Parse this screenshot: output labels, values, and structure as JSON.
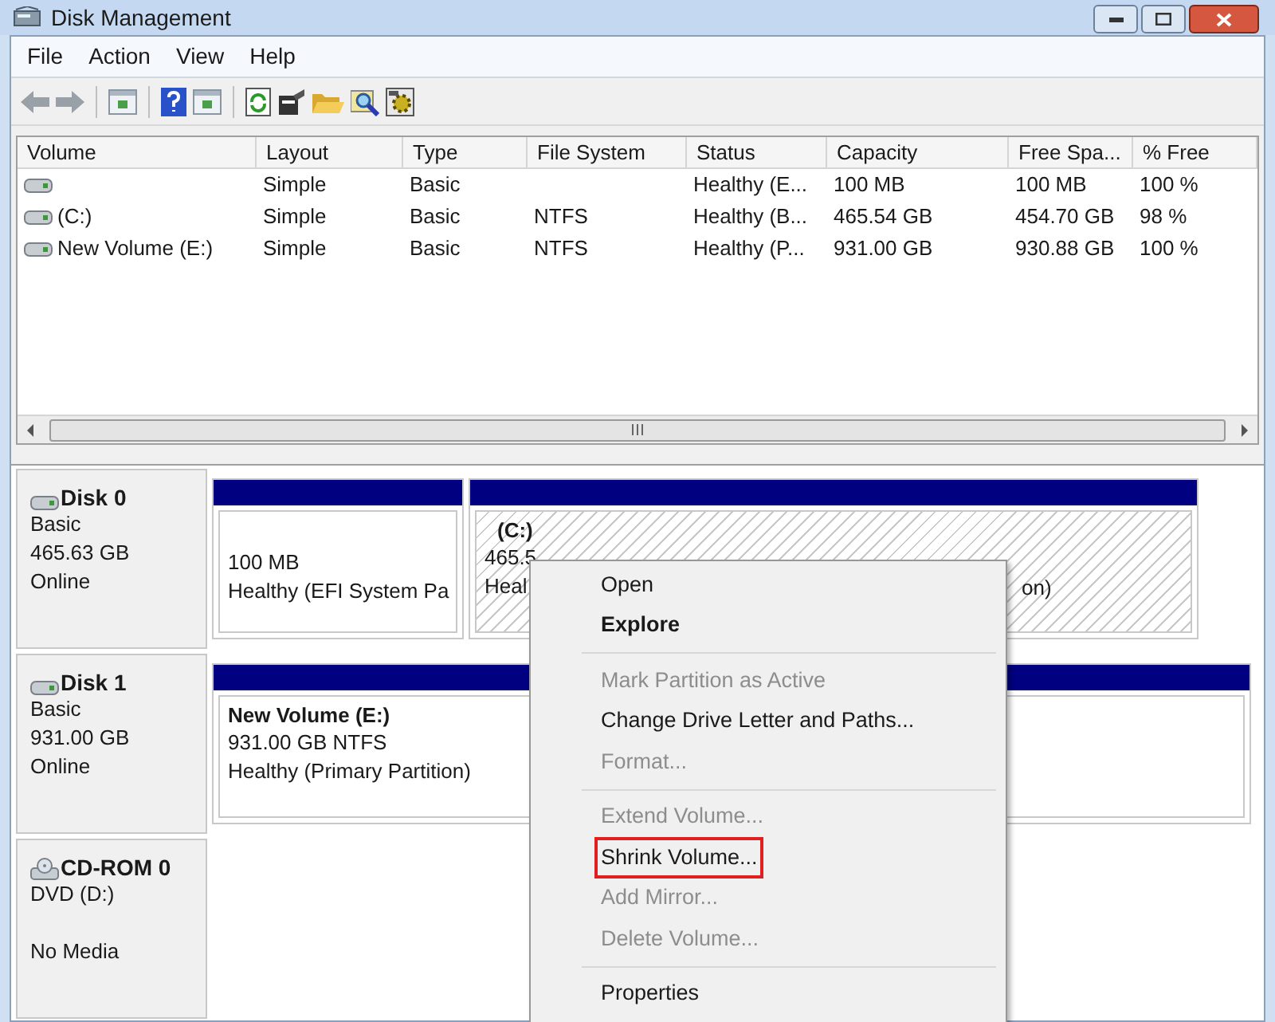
{
  "window": {
    "title": "Disk Management"
  },
  "menu_bar": [
    "File",
    "Action",
    "View",
    "Help"
  ],
  "volume_table": {
    "columns": [
      "Volume",
      "Layout",
      "Type",
      "File System",
      "Status",
      "Capacity",
      "Free Spa...",
      "% Free"
    ],
    "rows": [
      {
        "cells": [
          "",
          "Simple",
          "Basic",
          "",
          "Healthy (E...",
          "100 MB",
          "100 MB",
          "100 %"
        ]
      },
      {
        "cells": [
          "(C:)",
          "Simple",
          "Basic",
          "NTFS",
          "Healthy (B...",
          "465.54 GB",
          "454.70 GB",
          "98 %"
        ]
      },
      {
        "cells": [
          "New Volume (E:)",
          "Simple",
          "Basic",
          "NTFS",
          "Healthy (P...",
          "931.00 GB",
          "930.88 GB",
          "100 %"
        ]
      }
    ]
  },
  "disks": [
    {
      "name": "Disk 0",
      "kind": "hdd",
      "lines": [
        "Basic",
        "465.63 GB",
        "Online"
      ],
      "partitions": [
        {
          "lines": [
            "100 MB",
            "Healthy (EFI System Pa"
          ],
          "hatched": false
        },
        {
          "title": "(C:)",
          "lines": [
            "465.5",
            "Heal"
          ],
          "hatched": true,
          "tail": "on)"
        }
      ]
    },
    {
      "name": "Disk 1",
      "kind": "hdd",
      "lines": [
        "Basic",
        "931.00 GB",
        "Online"
      ],
      "partitions": [
        {
          "title": "New Volume  (E:)",
          "lines": [
            "931.00 GB NTFS",
            "Healthy (Primary Partition)"
          ],
          "hatched": false
        }
      ]
    },
    {
      "name": "CD-ROM 0",
      "kind": "cdrom",
      "lines": [
        "DVD (D:)",
        "No Media"
      ]
    }
  ],
  "context_menu": [
    {
      "kind": "item",
      "label": "Open",
      "disabled": false,
      "bold": false,
      "outlined": false
    },
    {
      "kind": "item",
      "label": "Explore",
      "disabled": false,
      "bold": true,
      "outlined": false
    },
    {
      "kind": "separator"
    },
    {
      "kind": "item",
      "label": "Mark Partition as Active",
      "disabled": true,
      "bold": false,
      "outlined": false
    },
    {
      "kind": "item",
      "label": "Change Drive Letter and Paths...",
      "disabled": false,
      "bold": false,
      "outlined": false
    },
    {
      "kind": "item",
      "label": "Format...",
      "disabled": true,
      "bold": false,
      "outlined": false
    },
    {
      "kind": "separator"
    },
    {
      "kind": "item",
      "label": "Extend Volume...",
      "disabled": true,
      "bold": false,
      "outlined": false
    },
    {
      "kind": "item",
      "label": "Shrink Volume...",
      "disabled": false,
      "bold": false,
      "outlined": true
    },
    {
      "kind": "item",
      "label": "Add Mirror...",
      "disabled": true,
      "bold": false,
      "outlined": false
    },
    {
      "kind": "item",
      "label": "Delete Volume...",
      "disabled": true,
      "bold": false,
      "outlined": false
    },
    {
      "kind": "separator"
    },
    {
      "kind": "item",
      "label": "Properties",
      "disabled": false,
      "bold": false,
      "outlined": false
    }
  ]
}
